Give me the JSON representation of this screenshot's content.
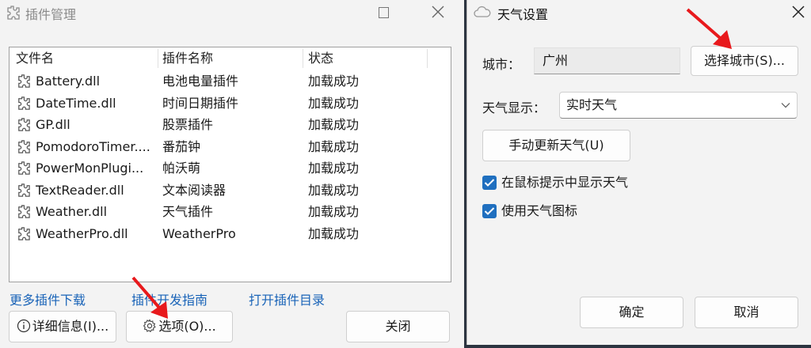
{
  "left_window": {
    "title": "插件管理",
    "icons": {
      "title": "plugin-icon",
      "maximize": "maximize-icon",
      "close": "close-icon"
    },
    "columns": [
      "文件名",
      "插件名称",
      "状态"
    ],
    "rows": [
      {
        "file": "Battery.dll",
        "name": "电池电量插件",
        "status": "加载成功"
      },
      {
        "file": "DateTime.dll",
        "name": "时间日期插件",
        "status": "加载成功"
      },
      {
        "file": "GP.dll",
        "name": "股票插件",
        "status": "加载成功"
      },
      {
        "file": "PomodoroTimer....",
        "name": "番茄钟",
        "status": "加载成功"
      },
      {
        "file": "PowerMonPlugi...",
        "name": "帕沃萌",
        "status": "加载成功"
      },
      {
        "file": "TextReader.dll",
        "name": "文本阅读器",
        "status": "加载成功"
      },
      {
        "file": "Weather.dll",
        "name": "天气插件",
        "status": "加载成功"
      },
      {
        "file": "WeatherPro.dll",
        "name": "WeatherPro",
        "status": "加载成功"
      }
    ],
    "links": {
      "more_plugins": "更多插件下载",
      "dev_guide": "插件开发指南",
      "open_dir": "打开插件目录"
    },
    "buttons": {
      "details": "详细信息(I)...",
      "options": "选项(O)...",
      "close": "关闭"
    }
  },
  "right_window": {
    "title": "天气设置",
    "icons": {
      "title": "cloud-icon",
      "close": "close-icon",
      "dropdown": "chevron-down-icon"
    },
    "city_label": "城市：",
    "city_value": "广州",
    "select_city_button": "选择城市(S)...",
    "weather_display_label": "天气显示：",
    "weather_display_value": "实时天气",
    "update_button": "手动更新天气(U)",
    "checkboxes": [
      {
        "label": "在鼠标提示中显示天气",
        "checked": true
      },
      {
        "label": "使用天气图标",
        "checked": true
      }
    ],
    "ok_button": "确定",
    "cancel_button": "取消"
  },
  "colors": {
    "accent": "#1f6fbf",
    "link": "#1a64b8",
    "annotation_arrow": "#e8191c"
  }
}
